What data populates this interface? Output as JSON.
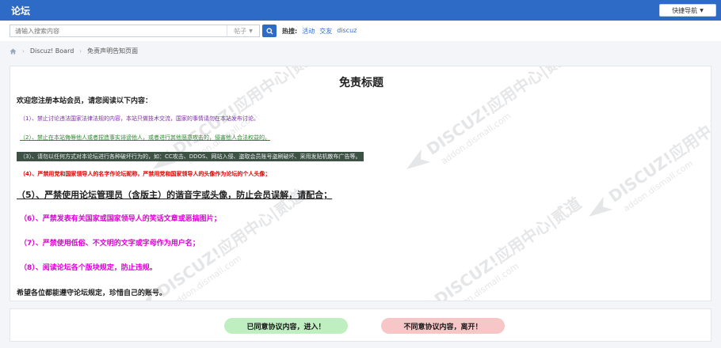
{
  "header": {
    "logo": "论坛",
    "quick_nav_label": "快捷导航",
    "quick_nav_icon": "caret-down-icon"
  },
  "search": {
    "placeholder": "请输入搜索内容",
    "type_label": "帖子",
    "button_icon": "search-icon",
    "hot_label": "热搜:",
    "hot_links": [
      "活动",
      "交友",
      "discuz"
    ]
  },
  "breadcrumb": {
    "home_icon": "home-icon",
    "items": [
      "Discuz! Board",
      "免责声明告知页面"
    ]
  },
  "notice": {
    "title": "免责标题",
    "welcome": "欢迎您注册本站会员，请您阅读以下内容：",
    "rules": [
      "（1）、禁止讨论违法国家法律法规的内容，本站只做技术交流，国家的事情请勿在本站发布讨论。",
      "（2）、禁止在本站侮辱他人或者捏造事实诽谤他人，或者进行其他恶意攻击的，侵害他人合法权益的。",
      "（3）、请勿以任何方式对本论坛进行各种破坏行为的，如：CC攻击、DDOS、网站入侵、盗取会员账号盗刷破坏、采用发贴机散布广告等。",
      "（4）、严禁用党和国家领导人的名字作论坛昵称，严禁用党和国家领导人的头像作为论坛的个人头像；",
      "（5）、严禁使用论坛管理员（含版主）的谐音字或头像，防止会员误解，请配合；",
      "（6）、严禁发表有关国家或国家领导人的笑话文章或恶搞图片；",
      "（7）、严禁使用低俗、不文明的文字或字母作为用户名；",
      "（8）、阅读论坛各个版块规定，防止违规。"
    ],
    "closing": "希望各位都能遵守论坛规定，珍惜自己的账号。",
    "rule_colors": {
      "purple": "#7b2ea3",
      "green": "#2f8a2f",
      "red": "#e00000",
      "magenta": "#e000d8"
    }
  },
  "watermark": {
    "brand": "DISCUZ!应用中心|贰道",
    "url": "addon.dismall.com"
  },
  "actions": {
    "agree_label": "已同意协议内容，进入！",
    "disagree_label": "不同意协议内容，离开！"
  },
  "colors": {
    "brand_blue": "#2e6bc7",
    "agree_bg": "#bfeec1",
    "disagree_bg": "#f7c6c6"
  }
}
